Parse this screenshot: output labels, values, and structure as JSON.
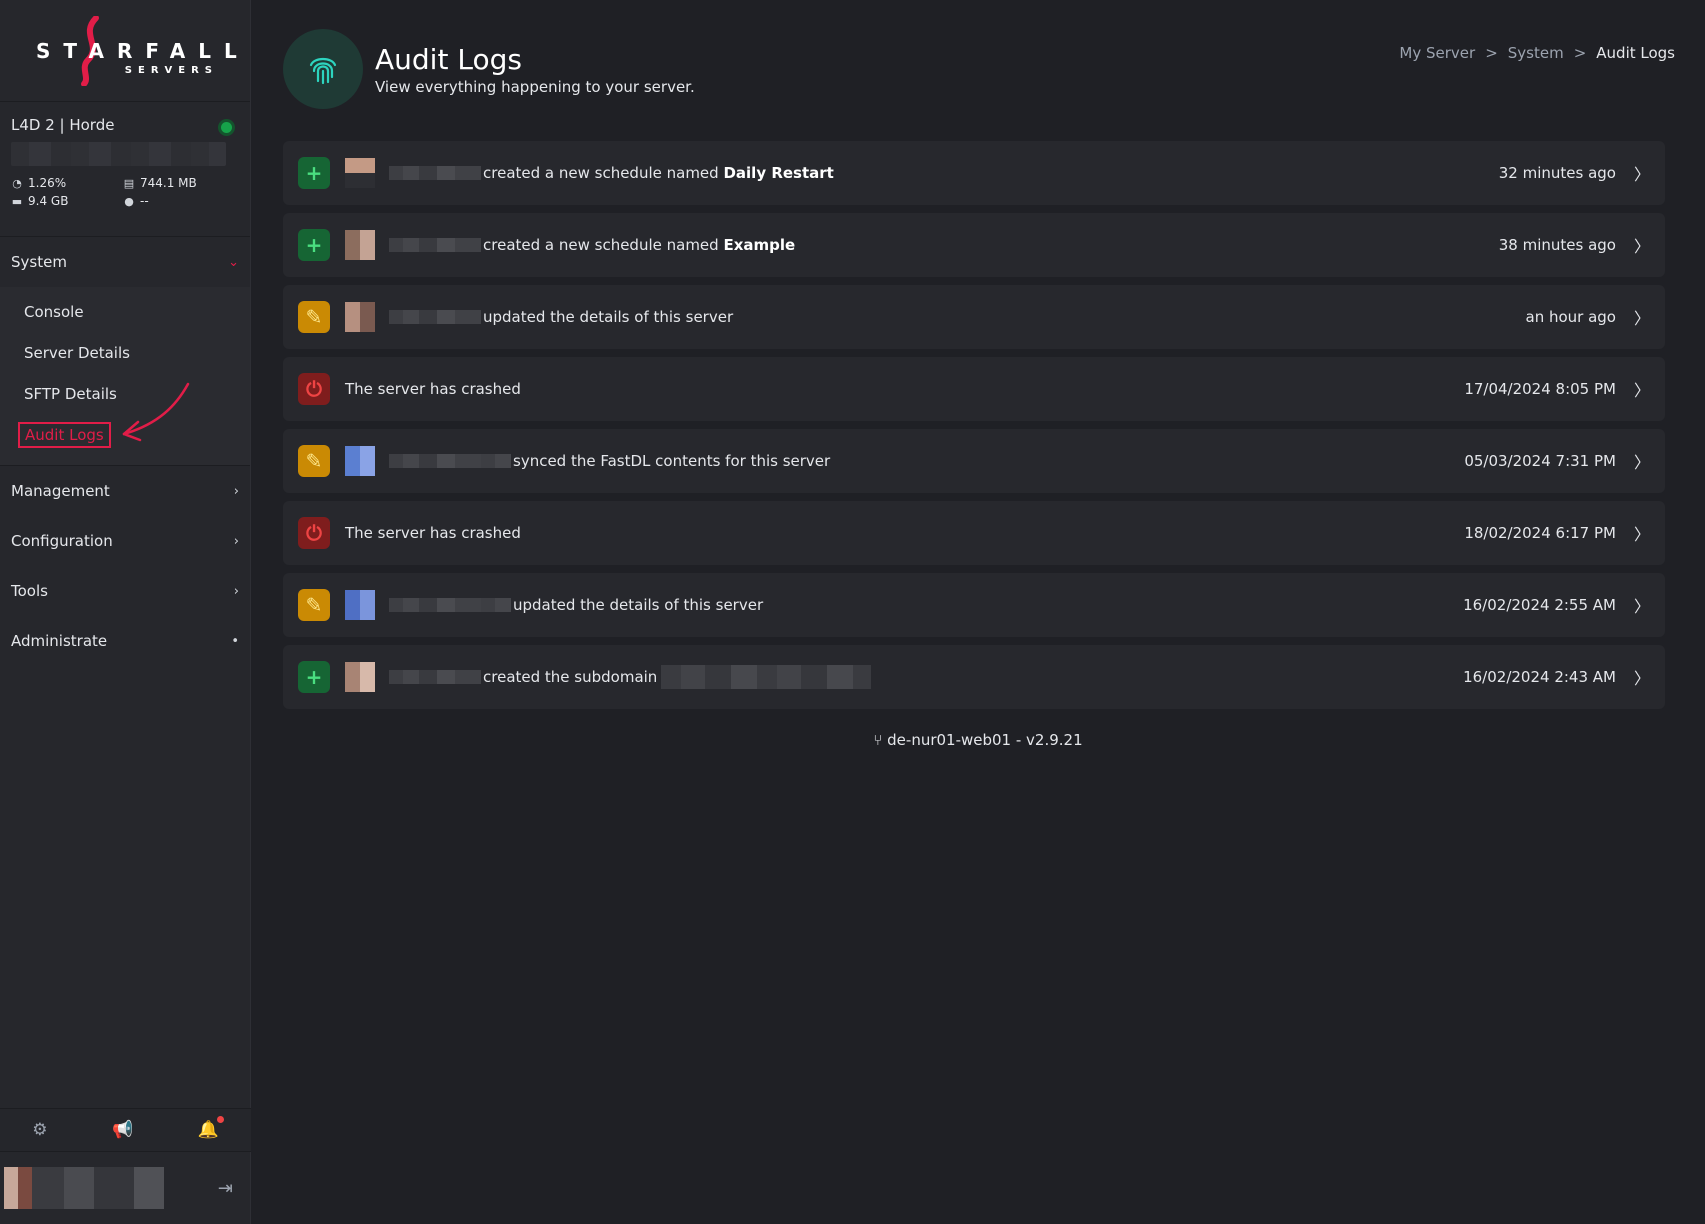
{
  "brand": {
    "name": "STARFALL",
    "sub": "SERVERS",
    "accent": "#e11d48"
  },
  "server": {
    "name": "L4D 2 | Horde",
    "cpu": "1.26%",
    "memory": "744.1 MB",
    "disk": "9.4 GB",
    "players": "--"
  },
  "nav": {
    "system": "System",
    "system_items": [
      "Console",
      "Server Details",
      "SFTP Details",
      "Audit Logs"
    ],
    "management": "Management",
    "configuration": "Configuration",
    "tools": "Tools",
    "administrate": "Administrate"
  },
  "header": {
    "title": "Audit Logs",
    "subtitle": "View everything happening to your server."
  },
  "breadcrumb": [
    "My Server",
    "System",
    "Audit Logs"
  ],
  "logs": [
    {
      "type": "create",
      "text": "created a new schedule named ",
      "bold": "Daily Restart",
      "time": "32 minutes ago"
    },
    {
      "type": "create",
      "text": "created a new schedule named ",
      "bold": "Example",
      "time": "38 minutes ago"
    },
    {
      "type": "update",
      "text": "updated the details of this server",
      "bold": "",
      "time": "an hour ago"
    },
    {
      "type": "crash",
      "text": "The server has crashed",
      "bold": "",
      "time": "17/04/2024 8:05 PM"
    },
    {
      "type": "update",
      "text": "synced the FastDL contents for this server",
      "bold": "",
      "time": "05/03/2024 7:31 PM"
    },
    {
      "type": "crash",
      "text": "The server has crashed",
      "bold": "",
      "time": "18/02/2024 6:17 PM"
    },
    {
      "type": "update",
      "text": "updated the details of this server",
      "bold": "",
      "time": "16/02/2024 2:55 AM"
    },
    {
      "type": "create",
      "text": "created the subdomain",
      "bold": "",
      "time": "16/02/2024 2:43 AM"
    }
  ],
  "version": "de-nur01-web01 - v2.9.21"
}
